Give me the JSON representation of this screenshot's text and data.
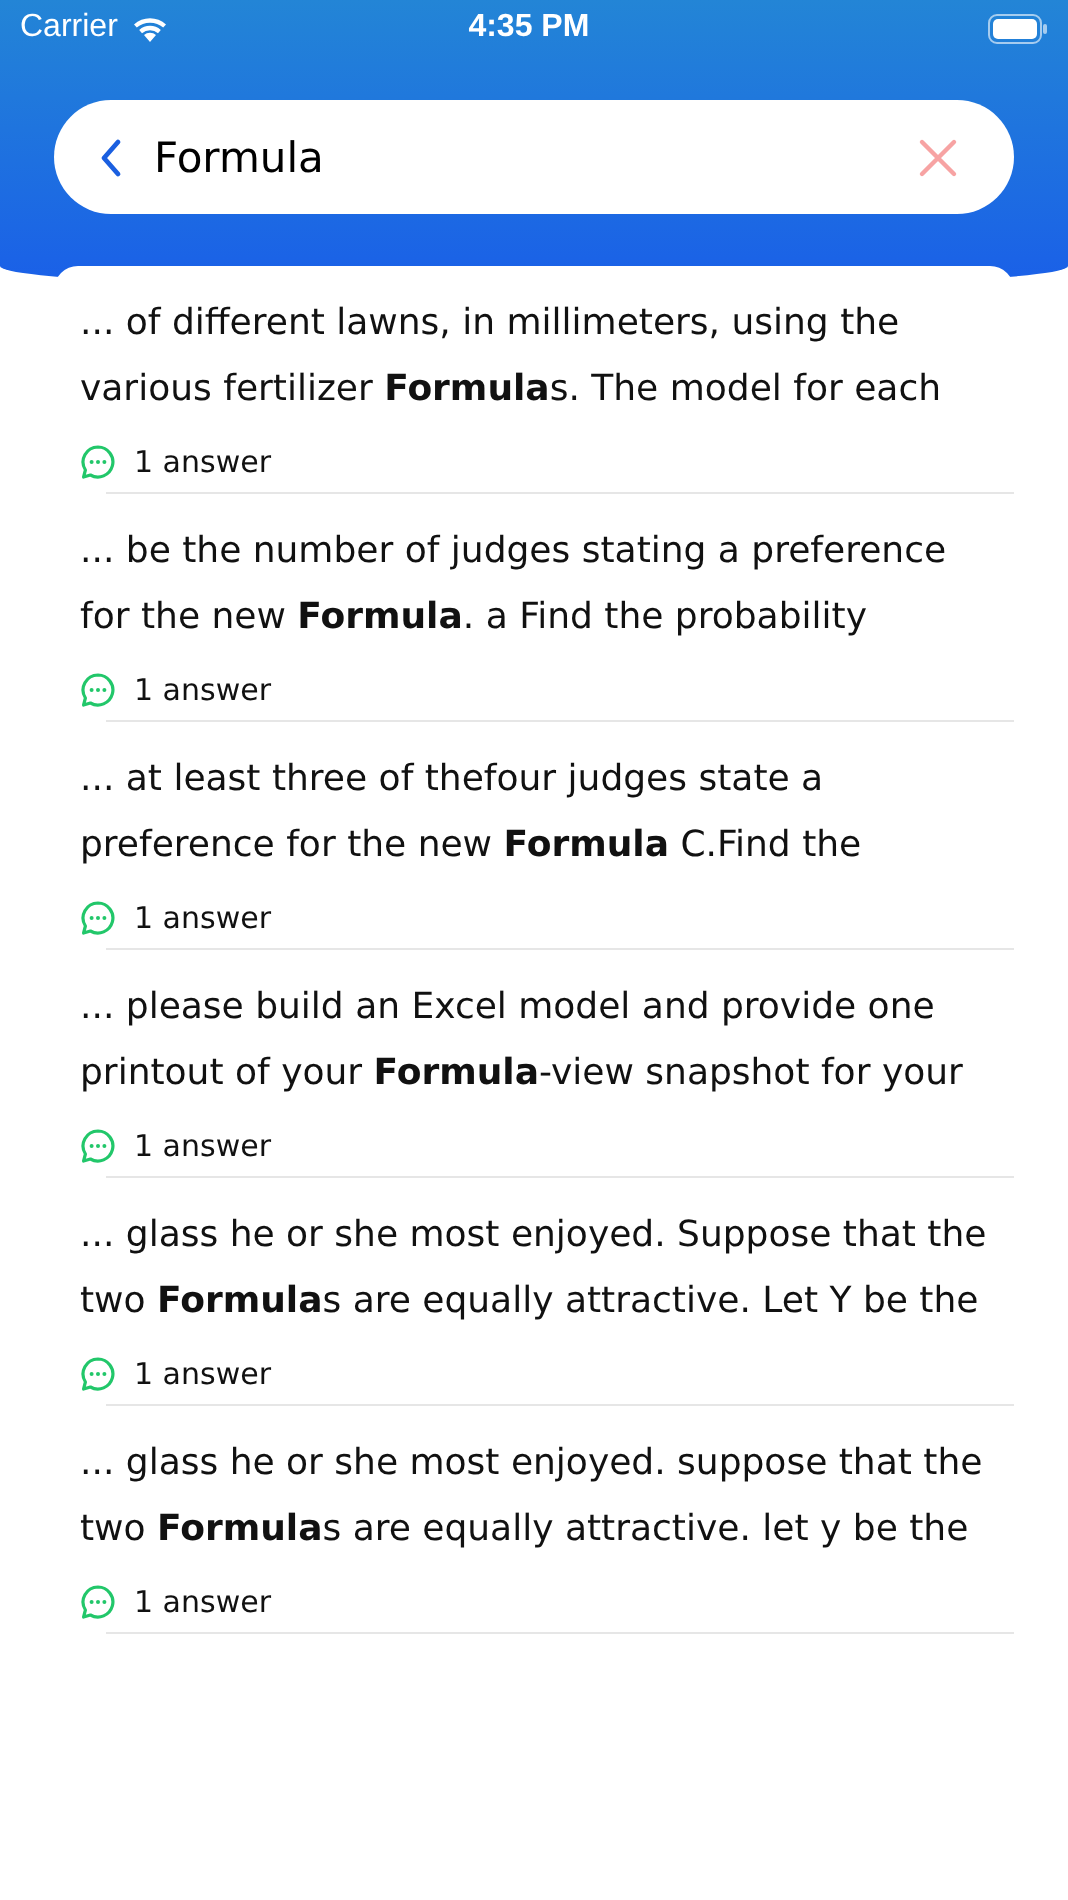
{
  "status_bar": {
    "carrier": "Carrier",
    "time": "4:35 PM"
  },
  "search": {
    "value": "Formula"
  },
  "results": [
    {
      "snippet": "... of different lawns, in millimeters, using the various fertilizer **Formula**s. The model for each",
      "answers": "1 answer"
    },
    {
      "snippet": "... be the number of judges stating a preference for the new **Formula**. a Find the probability",
      "answers": "1 answer"
    },
    {
      "snippet": "... at least three of thefour judges state a preference for the new **Formula** C.Find the",
      "answers": "1 answer"
    },
    {
      "snippet": "... please build an Excel model and provide one printout of your **Formula**-view snapshot for your",
      "answers": "1 answer"
    },
    {
      "snippet": "... glass he or she most enjoyed. Suppose that the two **Formula**s are equally attractive. Let Y be the",
      "answers": "1 answer"
    },
    {
      "snippet": "... glass he or she most enjoyed. suppose that the two **Formula**s are equally attractive. let y be the",
      "answers": "1 answer"
    }
  ]
}
